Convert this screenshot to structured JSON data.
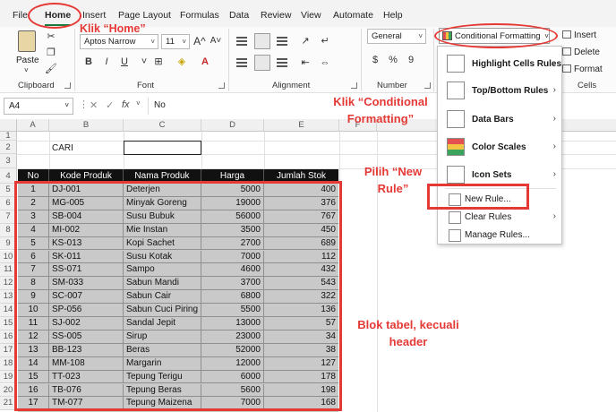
{
  "ribbon": {
    "tabs": [
      "File",
      "Home",
      "Insert",
      "Page Layout",
      "Formulas",
      "Data",
      "Review",
      "View",
      "Automate",
      "Help"
    ],
    "active_tab": "Home",
    "clipboard": {
      "paste_label": "Paste",
      "group_label": "Clipboard"
    },
    "font": {
      "name": "Aptos Narrow",
      "size": "11",
      "group_label": "Font",
      "grow": "A^",
      "shrink": "A˅",
      "bold": "B",
      "italic": "I",
      "underline": "U"
    },
    "alignment": {
      "group_label": "Alignment"
    },
    "number": {
      "format": "General",
      "group_label": "Number",
      "currency": "$",
      "percent": "%",
      "comma": "9"
    },
    "styles": {
      "conditional_formatting": "Conditional Formatting"
    },
    "cells": {
      "insert": "Insert",
      "delete": "Delete",
      "format": "Format",
      "group_label": "Cells"
    }
  },
  "formula_bar": {
    "name_box": "A4",
    "fx": "fx",
    "value": "No"
  },
  "columns": [
    "A",
    "B",
    "C",
    "D",
    "E",
    "F"
  ],
  "rows": [
    "1",
    "2",
    "3",
    "4",
    "5",
    "6",
    "7",
    "8",
    "9",
    "10",
    "11",
    "12",
    "13",
    "14",
    "15",
    "16",
    "17",
    "18",
    "19",
    "20",
    "21"
  ],
  "cari_label": "CARI",
  "table": {
    "headers": [
      "No",
      "Kode Produk",
      "Nama Produk",
      "Harga",
      "Jumlah Stok"
    ],
    "rows": [
      [
        "1",
        "DJ-001",
        "Deterjen",
        "5000",
        "400"
      ],
      [
        "2",
        "MG-005",
        "Minyak Goreng",
        "19000",
        "376"
      ],
      [
        "3",
        "SB-004",
        "Susu Bubuk",
        "56000",
        "767"
      ],
      [
        "4",
        "MI-002",
        "Mie Instan",
        "3500",
        "450"
      ],
      [
        "5",
        "KS-013",
        "Kopi Sachet",
        "2700",
        "689"
      ],
      [
        "6",
        "SK-011",
        "Susu Kotak",
        "7000",
        "112"
      ],
      [
        "7",
        "SS-071",
        "Sampo",
        "4600",
        "432"
      ],
      [
        "8",
        "SM-033",
        "Sabun Mandi",
        "3700",
        "543"
      ],
      [
        "9",
        "SC-007",
        "Sabun Cair",
        "6800",
        "322"
      ],
      [
        "10",
        "SP-056",
        "Sabun Cuci Piring",
        "5500",
        "136"
      ],
      [
        "11",
        "SJ-002",
        "Sandal Jepit",
        "13000",
        "57"
      ],
      [
        "12",
        "SS-005",
        "Sirup",
        "23000",
        "34"
      ],
      [
        "13",
        "BB-123",
        "Beras",
        "52000",
        "38"
      ],
      [
        "14",
        "MM-108",
        "Margarin",
        "12000",
        "127"
      ],
      [
        "15",
        "TT-023",
        "Tepung Terigu",
        "6000",
        "178"
      ],
      [
        "16",
        "TB-076",
        "Tepung Beras",
        "5600",
        "198"
      ],
      [
        "17",
        "TM-077",
        "Tepung Maizena",
        "7000",
        "168"
      ]
    ]
  },
  "menu": {
    "items": [
      {
        "label": "Highlight Cells Rules",
        "icon": "highlight-cells-icon",
        "submenu": true
      },
      {
        "label": "Top/Bottom Rules",
        "icon": "top-bottom-icon",
        "submenu": true
      },
      {
        "label": "Data Bars",
        "icon": "data-bars-icon",
        "submenu": true
      },
      {
        "label": "Color Scales",
        "icon": "color-scales-icon",
        "submenu": true
      },
      {
        "label": "Icon Sets",
        "icon": "icon-sets-icon",
        "submenu": true
      },
      {
        "label": "New Rule...",
        "icon": "new-rule-icon",
        "submenu": false
      },
      {
        "label": "Clear Rules",
        "icon": "clear-rules-icon",
        "submenu": true
      },
      {
        "label": "Manage Rules...",
        "icon": "manage-rules-icon",
        "submenu": false
      }
    ]
  },
  "annotations": {
    "home": "Klik “Home”",
    "cf_line1": "Klik “Conditional",
    "cf_line2": "Formatting”",
    "new_rule_line1": "Pilih “New",
    "new_rule_line2": "Rule”",
    "block_line1": "Blok tabel, kecuali",
    "block_line2": "header"
  },
  "colors": {
    "accent": "#1b7a3e",
    "annotation": "#e53935",
    "table_header": "#111111",
    "table_body": "#c9c9c9"
  }
}
